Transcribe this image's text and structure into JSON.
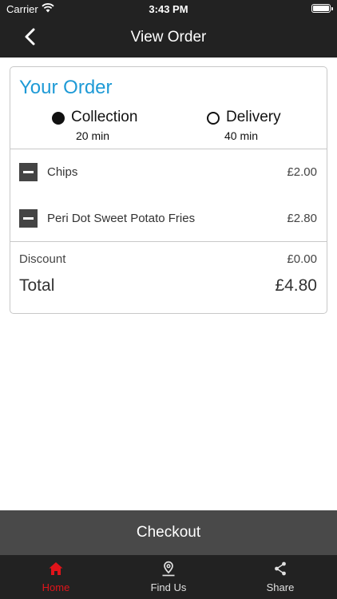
{
  "status_bar": {
    "carrier": "Carrier",
    "time": "3:43 PM"
  },
  "nav": {
    "title": "View Order",
    "back_icon": "chevron-left-icon"
  },
  "order": {
    "heading": "Your Order",
    "heading_color": "#1e9ad6",
    "options": [
      {
        "label": "Collection",
        "time": "20 min",
        "selected": true
      },
      {
        "label": "Delivery",
        "time": "40 min",
        "selected": false
      }
    ],
    "items": [
      {
        "name": "Chips",
        "price": "£2.00"
      },
      {
        "name": "Peri Dot Sweet Potato Fries",
        "price": "£2.80"
      }
    ],
    "discount_label": "Discount",
    "discount_value": "£0.00",
    "total_label": "Total",
    "total_value": "£4.80"
  },
  "checkout_label": "Checkout",
  "tabs": [
    {
      "label": "Home",
      "icon": "home-icon",
      "active": true
    },
    {
      "label": "Find Us",
      "icon": "map-pin-icon",
      "active": false
    },
    {
      "label": "Share",
      "icon": "share-icon",
      "active": false
    }
  ],
  "colors": {
    "bar_background": "#222222",
    "checkout_background": "#494949",
    "active_tab": "#e0141a"
  }
}
